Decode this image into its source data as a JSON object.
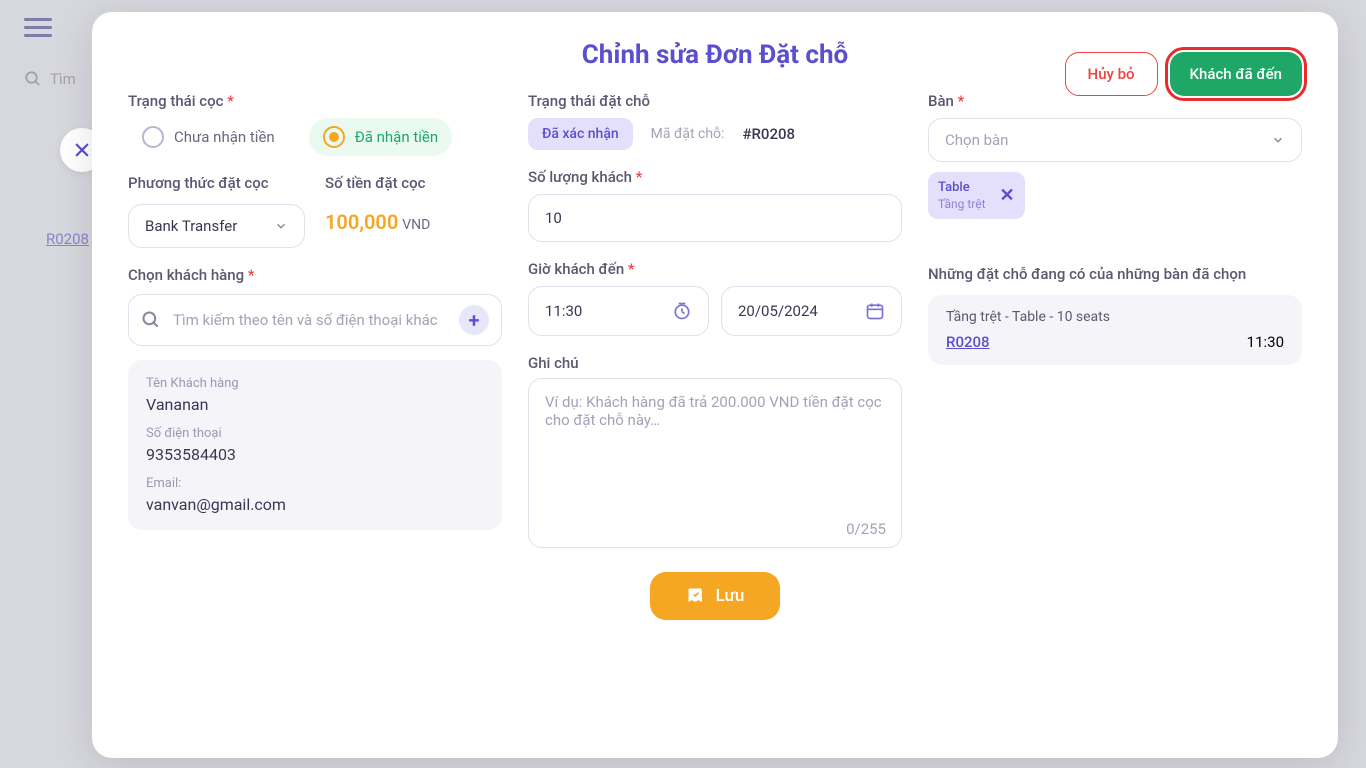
{
  "background": {
    "search_placeholder": "Tìm",
    "link": "R0208"
  },
  "modal": {
    "title": "Chỉnh sửa Đơn Đặt chỗ",
    "cancel": "Hủy bỏ",
    "arrived": "Khách đã đến"
  },
  "col1": {
    "deposit_status_label": "Trạng thái cọc",
    "radio_unreceived": "Chưa nhận tiền",
    "radio_received": "Đã nhận tiền",
    "method_label": "Phương thức đặt cọc",
    "method_value": "Bank Transfer",
    "amount_label": "Số tiền đặt cọc",
    "amount_value": "100,000",
    "amount_currency": "VND",
    "customer_label": "Chọn khách hàng",
    "customer_placeholder": "Tìm kiếm theo tên và số điện thoại khác",
    "card": {
      "name_lbl": "Tên Khách hàng",
      "name_val": "Vananan",
      "phone_lbl": "Số điện thoại",
      "phone_val": "9353584403",
      "email_lbl": "Email:",
      "email_val": "vanvan@gmail.com"
    }
  },
  "col2": {
    "res_status_label": "Trạng thái đặt chỗ",
    "badge": "Đã xác nhận",
    "code_lbl": "Mã đặt chỗ:",
    "code_val": "#R0208",
    "qty_label": "Số lượng khách",
    "qty_value": "10",
    "time_label": "Giờ khách đến",
    "time_value": "11:30",
    "date_value": "20/05/2024",
    "note_label": "Ghi chú",
    "note_placeholder": "Ví dụ: Khách hàng đã trả 200.000 VND tiền đặt cọc cho đặt chỗ này…",
    "char_count": "0/255"
  },
  "col3": {
    "table_label": "Bàn",
    "table_placeholder": "Chọn bàn",
    "chip": {
      "name": "Table",
      "floor": "Tầng trệt"
    },
    "existing_label": "Những đặt chỗ đang có của những bàn đã chọn",
    "existing_title": "Tầng trệt - Table  - 10 seats",
    "existing_code": "R0208",
    "existing_time": "11:30"
  },
  "save": "Lưu"
}
